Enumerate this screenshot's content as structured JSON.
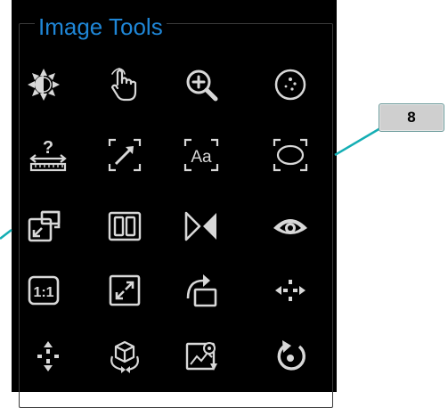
{
  "panel": {
    "title": "Image Tools",
    "title_color": "#1f86d6",
    "tools": [
      {
        "icon": "brightness-contrast-icon"
      },
      {
        "icon": "pan-hand-icon"
      },
      {
        "icon": "zoom-in-icon"
      },
      {
        "icon": "magnify-region-icon"
      },
      {
        "icon": "calibrate-ruler-icon"
      },
      {
        "icon": "line-measure-icon"
      },
      {
        "icon": "text-annotation-icon"
      },
      {
        "icon": "ellipse-roi-icon"
      },
      {
        "icon": "fit-to-window-icon"
      },
      {
        "icon": "split-view-icon"
      },
      {
        "icon": "flip-horizontal-icon"
      },
      {
        "icon": "show-hide-annotations-icon"
      },
      {
        "icon": "actual-size-icon"
      },
      {
        "icon": "full-screen-icon"
      },
      {
        "icon": "rotate-right-icon"
      },
      {
        "icon": "horizontal-crosshair-icon"
      },
      {
        "icon": "vertical-crosshair-icon"
      },
      {
        "icon": "3d-rotate-icon"
      },
      {
        "icon": "export-image-icon"
      },
      {
        "icon": "reset-icon"
      }
    ],
    "actual_size_label": "1:1",
    "text_tool_label": "Aa",
    "calibrate_label": "?"
  },
  "callout": {
    "label": "8",
    "color": "#14aeb4"
  }
}
